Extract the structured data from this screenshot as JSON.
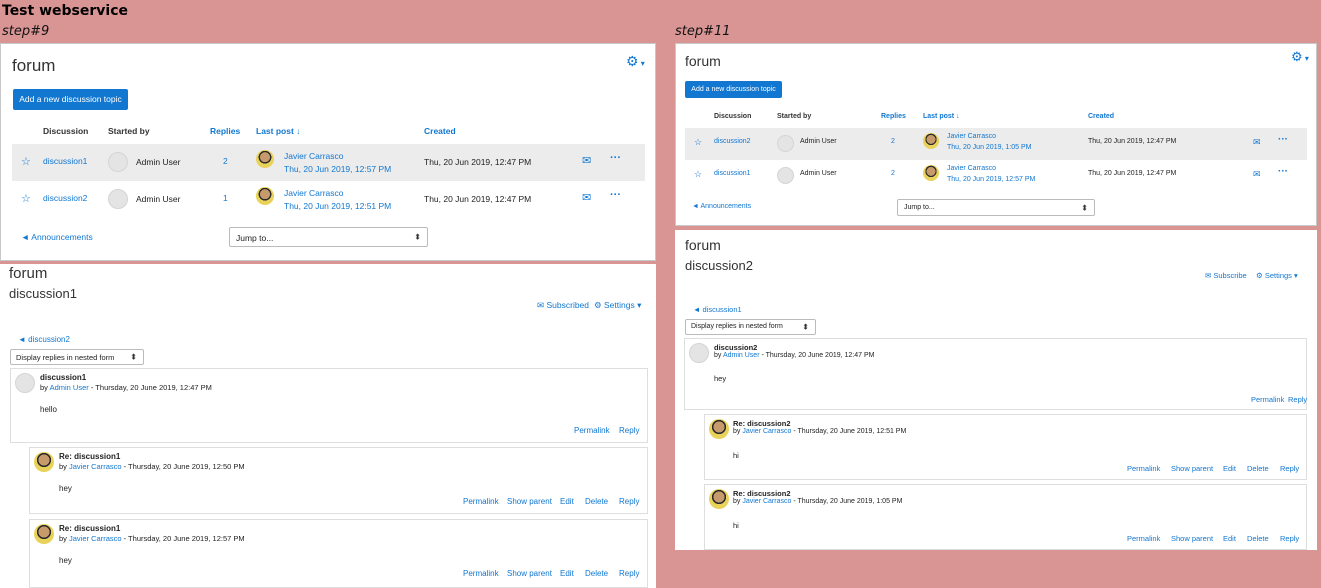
{
  "page_title": "Test webservice",
  "left": {
    "step": "step#9",
    "forum": {
      "title": "forum",
      "add_button": "Add a new discussion topic",
      "columns": {
        "discussion": "Discussion",
        "started_by": "Started by",
        "replies": "Replies",
        "last_post": "Last post",
        "created": "Created"
      },
      "rows": [
        {
          "name": "discussion1",
          "started": "Admin User",
          "replies": "2",
          "last_author": "Javier Carrasco",
          "last_date": "Thu, 20 Jun 2019, 12:57 PM",
          "created": "Thu, 20 Jun 2019, 12:47 PM"
        },
        {
          "name": "discussion2",
          "started": "Admin User",
          "replies": "1",
          "last_author": "Javier Carrasco",
          "last_date": "Thu, 20 Jun 2019, 12:51 PM",
          "created": "Thu, 20 Jun 2019, 12:47 PM"
        }
      ],
      "announcements": "◄ Announcements",
      "jump_to": "Jump to..."
    },
    "discussion": {
      "forum": "forum",
      "title": "discussion1",
      "subscribed": "Subscribed",
      "settings": "Settings",
      "prev_link": "◄ discussion2",
      "display_mode": "Display replies in nested form",
      "posts": [
        {
          "subject": "discussion1",
          "by": "by",
          "author": "Admin User",
          "date": " - Thursday, 20 June 2019, 12:47 PM",
          "body": "hello",
          "actions": [
            "Permalink",
            "Reply"
          ]
        },
        {
          "subject": "Re: discussion1",
          "by": "by",
          "author": "Javier Carrasco",
          "date": " - Thursday, 20 June 2019, 12:50 PM",
          "body": "hey",
          "actions": [
            "Permalink",
            "Show parent",
            "Edit",
            "Delete",
            "Reply"
          ]
        },
        {
          "subject": "Re: discussion1",
          "by": "by",
          "author": "Javier Carrasco",
          "date": " - Thursday, 20 June 2019, 12:57 PM",
          "body": "hey",
          "actions": [
            "Permalink",
            "Show parent",
            "Edit",
            "Delete",
            "Reply"
          ]
        }
      ]
    }
  },
  "right": {
    "step": "step#11",
    "forum": {
      "title": "forum",
      "add_button": "Add a new discussion topic",
      "columns": {
        "discussion": "Discussion",
        "started_by": "Started by",
        "replies": "Replies",
        "last_post": "Last post",
        "created": "Created"
      },
      "rows": [
        {
          "name": "discussion2",
          "started": "Admin User",
          "replies": "2",
          "last_author": "Javier Carrasco",
          "last_date": "Thu, 20 Jun 2019, 1:05 PM",
          "created": "Thu, 20 Jun 2019, 12:47 PM"
        },
        {
          "name": "discussion1",
          "started": "Admin User",
          "replies": "2",
          "last_author": "Javier Carrasco",
          "last_date": "Thu, 20 Jun 2019, 12:57 PM",
          "created": "Thu, 20 Jun 2019, 12:47 PM"
        }
      ],
      "announcements": "◄ Announcements",
      "jump_to": "Jump to..."
    },
    "discussion": {
      "forum": "forum",
      "title": "discussion2",
      "subscribe": "Subscribe",
      "settings": "Settings",
      "prev_link": "◄ discussion1",
      "display_mode": "Display replies in nested form",
      "posts": [
        {
          "subject": "discussion2",
          "by": "by",
          "author": "Admin User",
          "date": " - Thursday, 20 June 2019, 12:47 PM",
          "body": "hey",
          "actions": [
            "Permalink",
            "Reply"
          ]
        },
        {
          "subject": "Re: discussion2",
          "by": "by",
          "author": "Javier Carrasco",
          "date": " - Thursday, 20 June 2019, 12:51 PM",
          "body": "hi",
          "actions": [
            "Permalink",
            "Show parent",
            "Edit",
            "Delete",
            "Reply"
          ]
        },
        {
          "subject": "Re: discussion2",
          "by": "by",
          "author": "Javier Carrasco",
          "date": " - Thursday, 20 June 2019, 1:05 PM",
          "body": "hi",
          "actions": [
            "Permalink",
            "Show parent",
            "Edit",
            "Delete",
            "Reply"
          ]
        }
      ]
    }
  },
  "icons": {
    "gear": "gear-icon",
    "star": "star-icon",
    "mail": "mail-icon",
    "mail_open": "mail-open-icon",
    "more": "more-icon",
    "sort": "sort-down-icon",
    "caret": "caret-down-icon"
  },
  "colors": {
    "accent": "#1177d1",
    "background": "#d99594",
    "row_highlight": "#ececec"
  }
}
